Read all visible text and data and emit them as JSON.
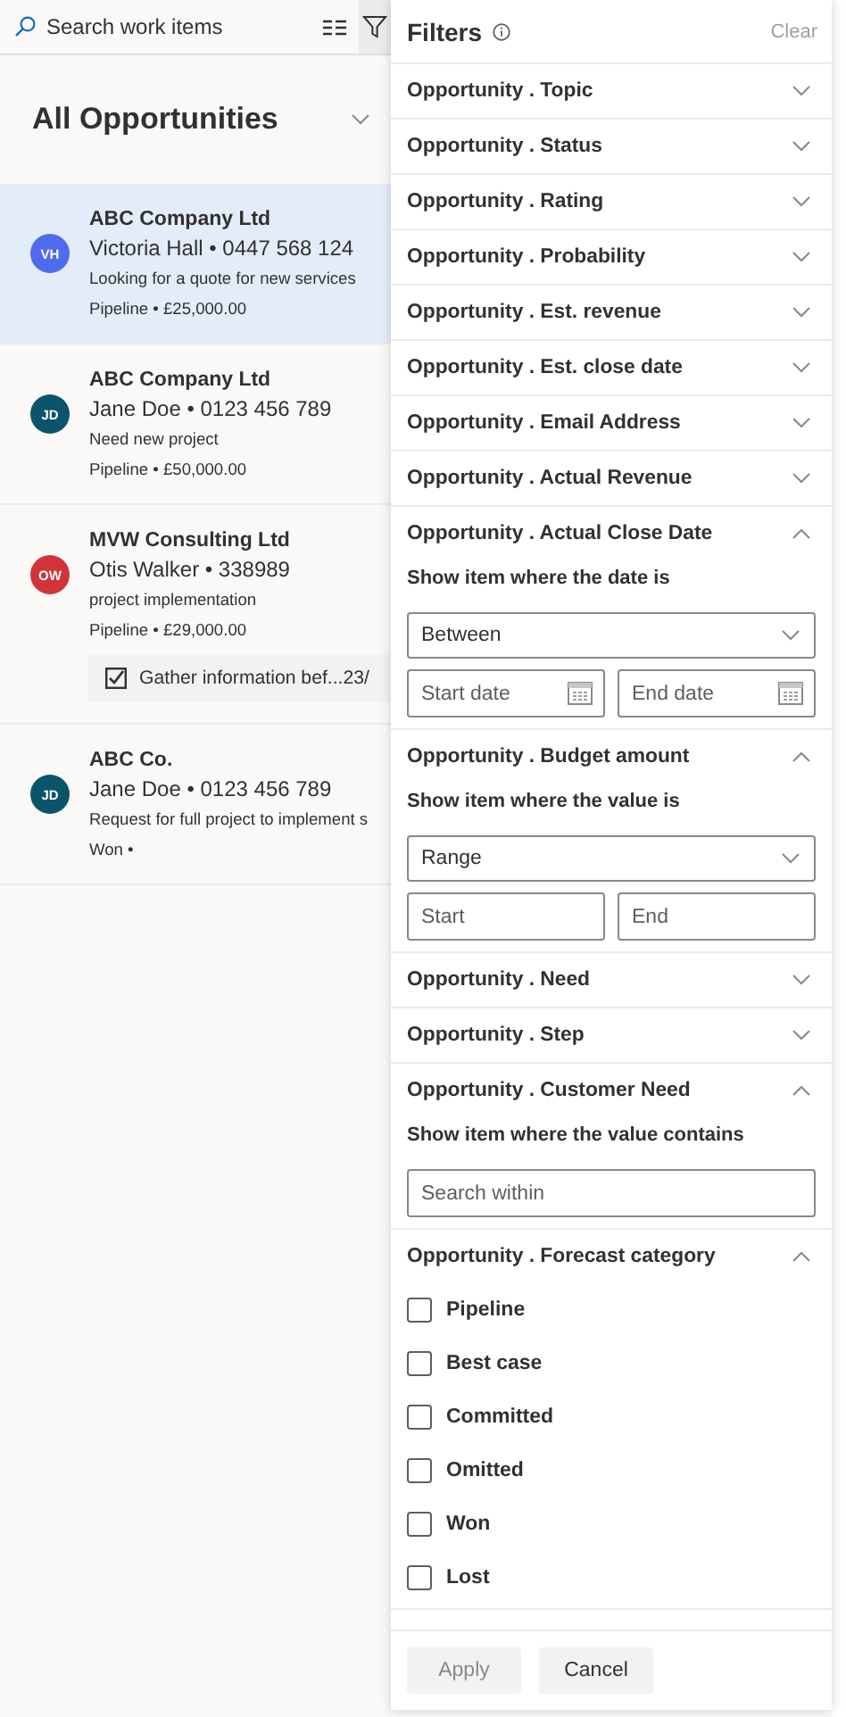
{
  "search": {
    "placeholder": "Search work items"
  },
  "filter_button": {
    "selected": true
  },
  "view": {
    "title": "All Opportunities"
  },
  "cards": [
    {
      "initials": "VH",
      "color": "#4f6bed",
      "title": "ABC Company Ltd",
      "contact": "Victoria Hall • 0447 568 124",
      "description": "Looking for a quote for new services",
      "status": "Pipeline • £25,000.00",
      "selected": true
    },
    {
      "initials": "JD",
      "color": "#0b556a",
      "title": "ABC Company Ltd",
      "contact": "Jane Doe • 0123 456 789",
      "description": "Need new project",
      "status": "Pipeline • £50,000.00",
      "selected": false
    },
    {
      "initials": "OW",
      "color": "#d13438",
      "title": "MVW Consulting Ltd",
      "contact": "Otis Walker • 338989",
      "description": "project implementation",
      "status": "Pipeline • £29,000.00",
      "selected": false,
      "task": {
        "label": "Gather information bef...23/",
        "checked": true
      }
    },
    {
      "initials": "JD",
      "color": "#0b556a",
      "title": "ABC Co.",
      "contact": "Jane Doe • 0123 456 789",
      "description": "Request for full project to implement s",
      "status": "Won •",
      "selected": false
    }
  ],
  "filters": {
    "title": "Filters",
    "clear": {
      "label": "Clear",
      "disabled": true
    },
    "sections": [
      {
        "label": "Opportunity . Topic",
        "expanded": false
      },
      {
        "label": "Opportunity . Status",
        "expanded": false
      },
      {
        "label": "Opportunity . Rating",
        "expanded": false
      },
      {
        "label": "Opportunity . Probability",
        "expanded": false
      },
      {
        "label": "Opportunity . Est. revenue",
        "expanded": false
      },
      {
        "label": "Opportunity . Est. close date",
        "expanded": false
      },
      {
        "label": "Opportunity . Email Address",
        "expanded": false
      },
      {
        "label": "Opportunity . Actual Revenue",
        "expanded": false
      },
      {
        "label": "Opportunity . Actual Close Date",
        "expanded": true,
        "kind": "date",
        "prompt": "Show item where the date is",
        "operator": "Between",
        "start_placeholder": "Start date",
        "end_placeholder": "End date"
      },
      {
        "label": "Opportunity . Budget amount",
        "expanded": true,
        "kind": "range",
        "prompt": "Show item where the value is",
        "operator": "Range",
        "start_placeholder": "Start",
        "end_placeholder": "End"
      },
      {
        "label": "Opportunity . Need",
        "expanded": false
      },
      {
        "label": "Opportunity . Step",
        "expanded": false
      },
      {
        "label": "Opportunity . Customer Need",
        "expanded": true,
        "kind": "text",
        "prompt": "Show item where the value contains",
        "placeholder": "Search within"
      },
      {
        "label": "Opportunity . Forecast category",
        "expanded": true,
        "kind": "choices",
        "options": [
          {
            "label": "Pipeline",
            "checked": false
          },
          {
            "label": "Best case",
            "checked": false
          },
          {
            "label": "Committed",
            "checked": false
          },
          {
            "label": "Omitted",
            "checked": false
          },
          {
            "label": "Won",
            "checked": false
          },
          {
            "label": "Lost",
            "checked": false
          }
        ]
      }
    ],
    "buttons": [
      {
        "label": "Apply",
        "disabled": true
      },
      {
        "label": "Cancel",
        "disabled": false
      }
    ]
  }
}
